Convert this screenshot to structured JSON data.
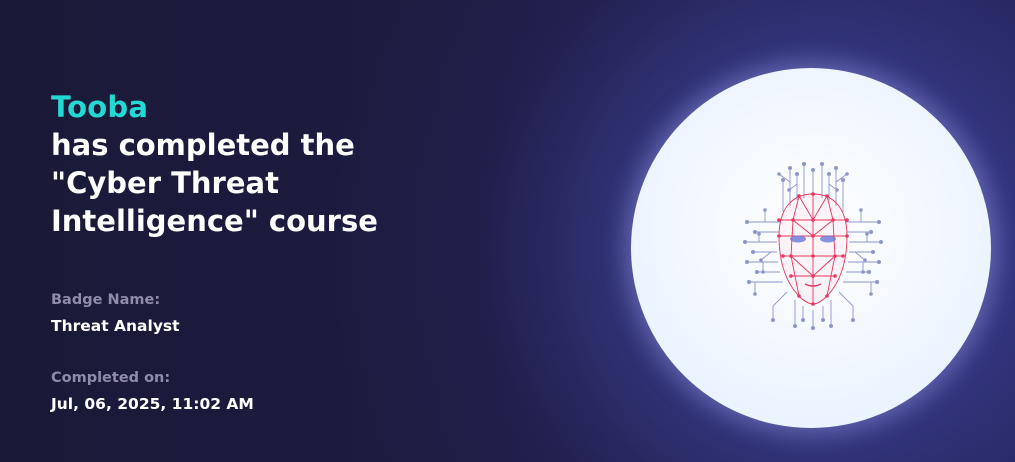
{
  "certificate": {
    "recipient_name": "Tooba",
    "headline": "has completed the \"Cyber Threat Intelligence\" course",
    "badge_label": "Badge Name:",
    "badge_value": "Threat Analyst",
    "completed_label": "Completed on:",
    "completed_value": "Jul, 06, 2025, 11:02 AM"
  },
  "illustration": {
    "icon": "ai-face-circuit-icon"
  },
  "colors": {
    "accent": "#24d8d4",
    "background": "#1b1a3d",
    "label": "#8e8ca8",
    "text": "#ffffff",
    "wireframe": "#e8365d",
    "circuit": "#8d96c9"
  }
}
